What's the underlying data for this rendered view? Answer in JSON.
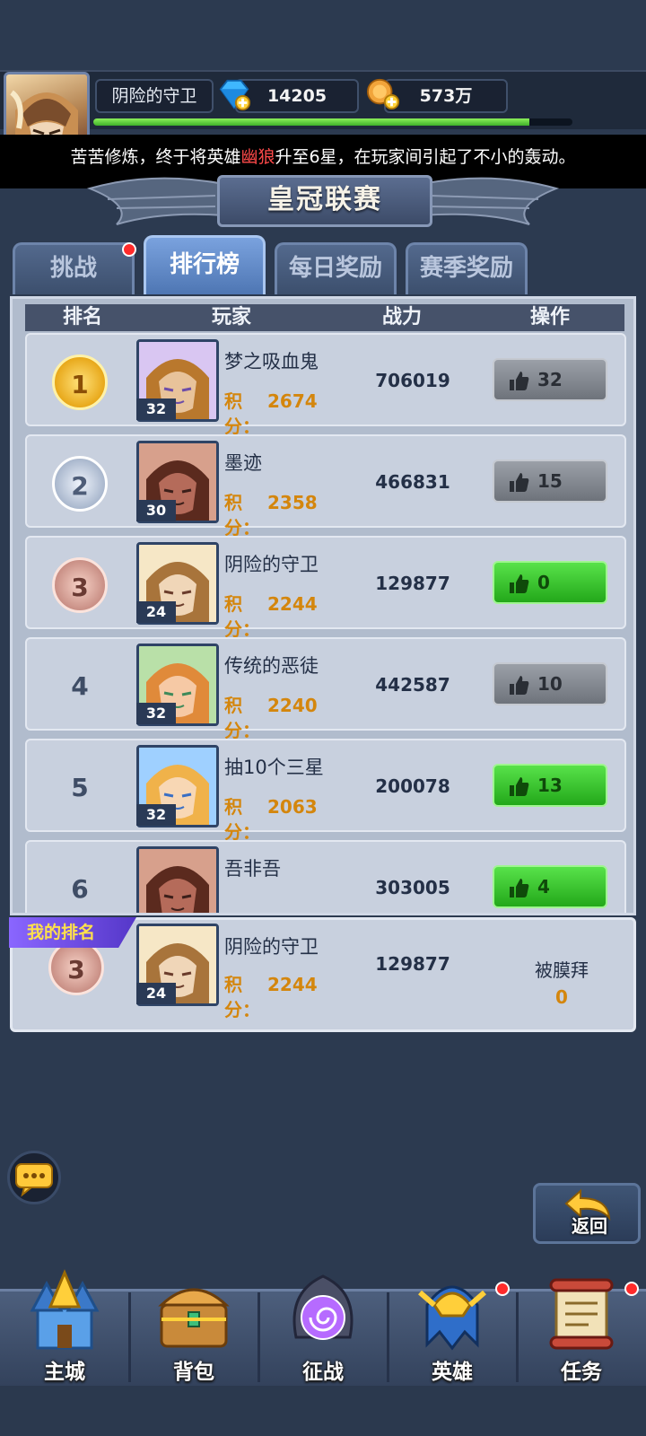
{
  "player": {
    "name": "阴险的守卫",
    "xp_fraction": 0.91
  },
  "resources": {
    "gems": "14205",
    "gold": "573万"
  },
  "marquee": {
    "pre": "苦苦修炼，终于将英雄",
    "hero": "幽狼",
    "post": "升至6星，在玩家间引起了不小的轰动。"
  },
  "title": "皇冠联赛",
  "tabs": [
    {
      "label": "挑战",
      "active": false,
      "badge": true
    },
    {
      "label": "排行榜",
      "active": true,
      "badge": false
    },
    {
      "label": "每日奖励",
      "active": false,
      "badge": false
    },
    {
      "label": "赛季奖励",
      "active": false,
      "badge": false
    }
  ],
  "table": {
    "headers": [
      "排名",
      "玩家",
      "战力",
      "操作"
    ],
    "score_label": "积分：",
    "rows": [
      {
        "rank": "1",
        "name": "梦之吸血鬼",
        "level": "32",
        "score": "2674",
        "power": "706019",
        "likes": "32",
        "liked": false,
        "portrait": "knight"
      },
      {
        "rank": "2",
        "name": "墨迹",
        "level": "30",
        "score": "2358",
        "power": "466831",
        "likes": "15",
        "liked": false,
        "portrait": "brute"
      },
      {
        "rank": "3",
        "name": "阴险的守卫",
        "level": "24",
        "score": "2244",
        "power": "129877",
        "likes": "0",
        "liked": true,
        "portrait": "guard"
      },
      {
        "rank": "4",
        "name": "传统的恶徒",
        "level": "32",
        "score": "2240",
        "power": "442587",
        "likes": "10",
        "liked": false,
        "portrait": "elf"
      },
      {
        "rank": "5",
        "name": "抽10个三星",
        "level": "32",
        "score": "2063",
        "power": "200078",
        "likes": "13",
        "liked": true,
        "portrait": "girl"
      },
      {
        "rank": "6",
        "name": "吾非吾",
        "level": "",
        "score": "",
        "power": "303005",
        "likes": "4",
        "liked": true,
        "portrait": "brute"
      }
    ]
  },
  "my_rank": {
    "tag": "我的排名",
    "rank": "3",
    "name": "阴险的守卫",
    "level": "24",
    "score": "2244",
    "power": "129877",
    "worship_label": "被膜拜",
    "worship_count": "0"
  },
  "return_label": "返回",
  "nav": [
    {
      "label": "主城",
      "badge": false,
      "icon": "castle-icon"
    },
    {
      "label": "背包",
      "badge": false,
      "icon": "chest-icon"
    },
    {
      "label": "征战",
      "badge": false,
      "icon": "portal-icon"
    },
    {
      "label": "英雄",
      "badge": true,
      "icon": "helmet-icon"
    },
    {
      "label": "任务",
      "badge": true,
      "icon": "scroll-icon"
    }
  ]
}
